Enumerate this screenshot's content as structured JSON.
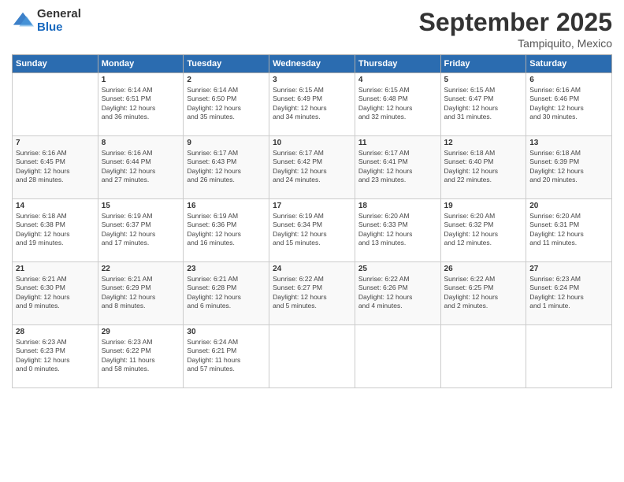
{
  "logo": {
    "general": "General",
    "blue": "Blue"
  },
  "title": "September 2025",
  "subtitle": "Tampiquito, Mexico",
  "headers": [
    "Sunday",
    "Monday",
    "Tuesday",
    "Wednesday",
    "Thursday",
    "Friday",
    "Saturday"
  ],
  "weeks": [
    [
      {
        "day": "",
        "info": ""
      },
      {
        "day": "1",
        "info": "Sunrise: 6:14 AM\nSunset: 6:51 PM\nDaylight: 12 hours\nand 36 minutes."
      },
      {
        "day": "2",
        "info": "Sunrise: 6:14 AM\nSunset: 6:50 PM\nDaylight: 12 hours\nand 35 minutes."
      },
      {
        "day": "3",
        "info": "Sunrise: 6:15 AM\nSunset: 6:49 PM\nDaylight: 12 hours\nand 34 minutes."
      },
      {
        "day": "4",
        "info": "Sunrise: 6:15 AM\nSunset: 6:48 PM\nDaylight: 12 hours\nand 32 minutes."
      },
      {
        "day": "5",
        "info": "Sunrise: 6:15 AM\nSunset: 6:47 PM\nDaylight: 12 hours\nand 31 minutes."
      },
      {
        "day": "6",
        "info": "Sunrise: 6:16 AM\nSunset: 6:46 PM\nDaylight: 12 hours\nand 30 minutes."
      }
    ],
    [
      {
        "day": "7",
        "info": "Sunrise: 6:16 AM\nSunset: 6:45 PM\nDaylight: 12 hours\nand 28 minutes."
      },
      {
        "day": "8",
        "info": "Sunrise: 6:16 AM\nSunset: 6:44 PM\nDaylight: 12 hours\nand 27 minutes."
      },
      {
        "day": "9",
        "info": "Sunrise: 6:17 AM\nSunset: 6:43 PM\nDaylight: 12 hours\nand 26 minutes."
      },
      {
        "day": "10",
        "info": "Sunrise: 6:17 AM\nSunset: 6:42 PM\nDaylight: 12 hours\nand 24 minutes."
      },
      {
        "day": "11",
        "info": "Sunrise: 6:17 AM\nSunset: 6:41 PM\nDaylight: 12 hours\nand 23 minutes."
      },
      {
        "day": "12",
        "info": "Sunrise: 6:18 AM\nSunset: 6:40 PM\nDaylight: 12 hours\nand 22 minutes."
      },
      {
        "day": "13",
        "info": "Sunrise: 6:18 AM\nSunset: 6:39 PM\nDaylight: 12 hours\nand 20 minutes."
      }
    ],
    [
      {
        "day": "14",
        "info": "Sunrise: 6:18 AM\nSunset: 6:38 PM\nDaylight: 12 hours\nand 19 minutes."
      },
      {
        "day": "15",
        "info": "Sunrise: 6:19 AM\nSunset: 6:37 PM\nDaylight: 12 hours\nand 17 minutes."
      },
      {
        "day": "16",
        "info": "Sunrise: 6:19 AM\nSunset: 6:36 PM\nDaylight: 12 hours\nand 16 minutes."
      },
      {
        "day": "17",
        "info": "Sunrise: 6:19 AM\nSunset: 6:34 PM\nDaylight: 12 hours\nand 15 minutes."
      },
      {
        "day": "18",
        "info": "Sunrise: 6:20 AM\nSunset: 6:33 PM\nDaylight: 12 hours\nand 13 minutes."
      },
      {
        "day": "19",
        "info": "Sunrise: 6:20 AM\nSunset: 6:32 PM\nDaylight: 12 hours\nand 12 minutes."
      },
      {
        "day": "20",
        "info": "Sunrise: 6:20 AM\nSunset: 6:31 PM\nDaylight: 12 hours\nand 11 minutes."
      }
    ],
    [
      {
        "day": "21",
        "info": "Sunrise: 6:21 AM\nSunset: 6:30 PM\nDaylight: 12 hours\nand 9 minutes."
      },
      {
        "day": "22",
        "info": "Sunrise: 6:21 AM\nSunset: 6:29 PM\nDaylight: 12 hours\nand 8 minutes."
      },
      {
        "day": "23",
        "info": "Sunrise: 6:21 AM\nSunset: 6:28 PM\nDaylight: 12 hours\nand 6 minutes."
      },
      {
        "day": "24",
        "info": "Sunrise: 6:22 AM\nSunset: 6:27 PM\nDaylight: 12 hours\nand 5 minutes."
      },
      {
        "day": "25",
        "info": "Sunrise: 6:22 AM\nSunset: 6:26 PM\nDaylight: 12 hours\nand 4 minutes."
      },
      {
        "day": "26",
        "info": "Sunrise: 6:22 AM\nSunset: 6:25 PM\nDaylight: 12 hours\nand 2 minutes."
      },
      {
        "day": "27",
        "info": "Sunrise: 6:23 AM\nSunset: 6:24 PM\nDaylight: 12 hours\nand 1 minute."
      }
    ],
    [
      {
        "day": "28",
        "info": "Sunrise: 6:23 AM\nSunset: 6:23 PM\nDaylight: 12 hours\nand 0 minutes."
      },
      {
        "day": "29",
        "info": "Sunrise: 6:23 AM\nSunset: 6:22 PM\nDaylight: 11 hours\nand 58 minutes."
      },
      {
        "day": "30",
        "info": "Sunrise: 6:24 AM\nSunset: 6:21 PM\nDaylight: 11 hours\nand 57 minutes."
      },
      {
        "day": "",
        "info": ""
      },
      {
        "day": "",
        "info": ""
      },
      {
        "day": "",
        "info": ""
      },
      {
        "day": "",
        "info": ""
      }
    ]
  ]
}
